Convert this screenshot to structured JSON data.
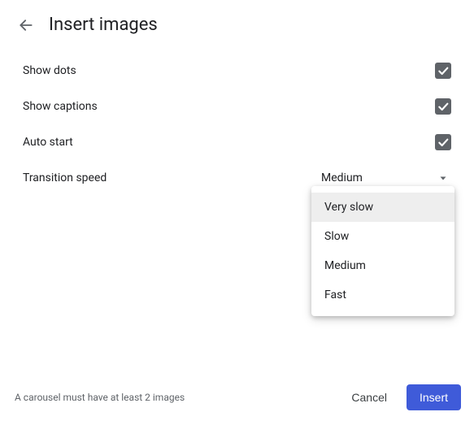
{
  "header": {
    "title": "Insert images"
  },
  "options": {
    "show_dots": {
      "label": "Show dots",
      "checked": true
    },
    "show_captions": {
      "label": "Show captions",
      "checked": true
    },
    "auto_start": {
      "label": "Auto start",
      "checked": true
    },
    "transition_speed": {
      "label": "Transition speed",
      "selected": "Medium",
      "items": [
        "Very slow",
        "Slow",
        "Medium",
        "Fast"
      ],
      "highlighted_index": 0
    }
  },
  "footer": {
    "message": "A carousel must have at least 2 images",
    "cancel": "Cancel",
    "insert": "Insert"
  }
}
